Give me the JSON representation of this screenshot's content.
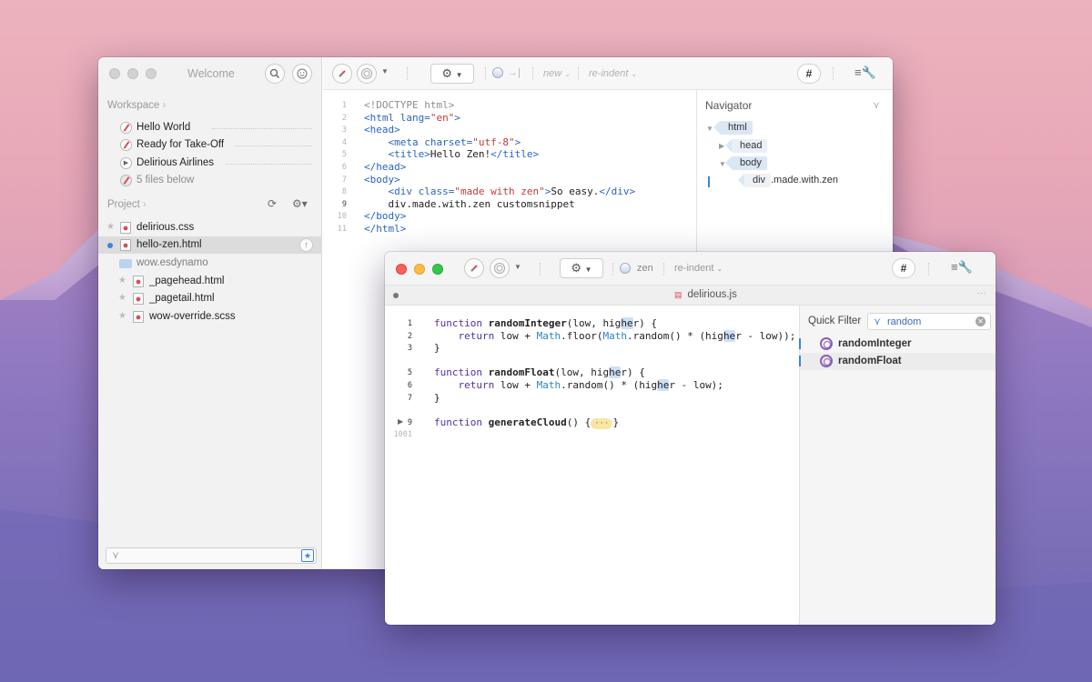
{
  "colors": {
    "accent": "#3b86d9",
    "tag": "#2a64c5",
    "string": "#c23b3b",
    "keyword": "#5131a8"
  },
  "back_window": {
    "title": "Welcome",
    "search_icon": "search-icon",
    "workspace": {
      "label": "Workspace",
      "items": [
        {
          "label": "Hello World",
          "icon": "compass-icon"
        },
        {
          "label": "Ready for Take-Off",
          "icon": "compass-icon"
        },
        {
          "label": "Delirious Airlines",
          "icon": "play-icon"
        },
        {
          "label": "5 files below",
          "icon": "stack-icon"
        }
      ]
    },
    "project": {
      "label": "Project",
      "items": [
        {
          "label": "delirious.css"
        },
        {
          "label": "hello-zen.html"
        },
        {
          "label": "wow.esdynamo"
        },
        {
          "label": "_pagehead.html"
        },
        {
          "label": "_pagetail.html"
        },
        {
          "label": "wow-override.scss"
        }
      ]
    },
    "toolbar": {
      "new": "new",
      "reindent": "re-indent",
      "hash": "#",
      "arrow": "→|"
    },
    "code": {
      "line_numbers": [
        "1",
        "2",
        "3",
        "4",
        "5",
        "6",
        "7",
        "8",
        "9",
        "10",
        "11"
      ],
      "current_line": "9",
      "lines": [
        [
          [
            "gray",
            "<!DOCTYPE html>"
          ]
        ],
        [
          [
            "tag",
            "<html "
          ],
          [
            "attr",
            "lang="
          ],
          [
            "str",
            "\"en\""
          ],
          [
            "tag",
            ">"
          ]
        ],
        [
          [
            "tag",
            "<head>"
          ]
        ],
        [
          [
            "plain",
            "    "
          ],
          [
            "tag",
            "<meta "
          ],
          [
            "attr",
            "charset="
          ],
          [
            "str",
            "\"utf-8\""
          ],
          [
            "tag",
            ">"
          ]
        ],
        [
          [
            "plain",
            "    "
          ],
          [
            "tag",
            "<title>"
          ],
          [
            "plain",
            "Hello Zen!"
          ],
          [
            "tag",
            "</title>"
          ]
        ],
        [
          [
            "tag",
            "</head>"
          ]
        ],
        [
          [
            "tag",
            "<body>"
          ]
        ],
        [
          [
            "plain",
            "    "
          ],
          [
            "tag",
            "<div "
          ],
          [
            "attr",
            "class="
          ],
          [
            "str",
            "\"made with zen\""
          ],
          [
            "tag",
            ">"
          ],
          [
            "plain",
            "So easy."
          ],
          [
            "tag",
            "</div>"
          ]
        ],
        [
          [
            "plain",
            "    div.made.with.zen customsnippet"
          ]
        ],
        [
          [
            "tag",
            "</body>"
          ]
        ],
        [
          [
            "tag",
            "</html>"
          ]
        ]
      ]
    },
    "navigator": {
      "title": "Navigator",
      "nodes": [
        "html",
        "head",
        "body",
        "div",
        ".made.with.zen"
      ]
    }
  },
  "front_window": {
    "toolbar": {
      "zen": "zen",
      "reindent": "re-indent",
      "hash": "#"
    },
    "tab": {
      "title": "delirious.js"
    },
    "code": {
      "line_numbers": [
        "1",
        "2",
        "3",
        "",
        "5",
        "6",
        "7",
        "",
        "9",
        "1001"
      ],
      "lines": [
        [
          [
            "kw",
            "function "
          ],
          [
            "fn",
            "randomInteger"
          ],
          [
            "plain",
            "(low, hig"
          ],
          [
            "hl",
            "he"
          ],
          [
            "plain",
            "r) {"
          ]
        ],
        [
          [
            "plain",
            "    "
          ],
          [
            "kw",
            "return "
          ],
          [
            "plain",
            "low + "
          ],
          [
            "bi",
            "Math"
          ],
          [
            "plain",
            ".floor("
          ],
          [
            "bi",
            "Math"
          ],
          [
            "plain",
            ".random() * (hig"
          ],
          [
            "hl",
            "he"
          ],
          [
            "plain",
            "r - low));"
          ]
        ],
        [
          [
            "plain",
            "}"
          ]
        ],
        [
          [
            "plain",
            ""
          ]
        ],
        [
          [
            "kw",
            "function "
          ],
          [
            "fn",
            "randomFloat"
          ],
          [
            "plain",
            "(low, hig"
          ],
          [
            "hl",
            "he"
          ],
          [
            "plain",
            "r) {"
          ]
        ],
        [
          [
            "plain",
            "    "
          ],
          [
            "kw",
            "return "
          ],
          [
            "plain",
            "low + "
          ],
          [
            "bi",
            "Math"
          ],
          [
            "plain",
            ".random() * (hig"
          ],
          [
            "hl",
            "he"
          ],
          [
            "plain",
            "r - low);"
          ]
        ],
        [
          [
            "plain",
            "}"
          ]
        ],
        [
          [
            "plain",
            ""
          ]
        ],
        [
          [
            "kw",
            "function "
          ],
          [
            "fn",
            "generateCloud"
          ],
          [
            "plain",
            "() {"
          ],
          [
            "fold",
            "···"
          ],
          [
            "plain",
            "}"
          ]
        ],
        [
          [
            "plain",
            ""
          ]
        ]
      ]
    },
    "quick_filter": {
      "label": "Quick Filter",
      "value": "random",
      "results": [
        "randomInteger",
        "randomFloat"
      ]
    }
  }
}
